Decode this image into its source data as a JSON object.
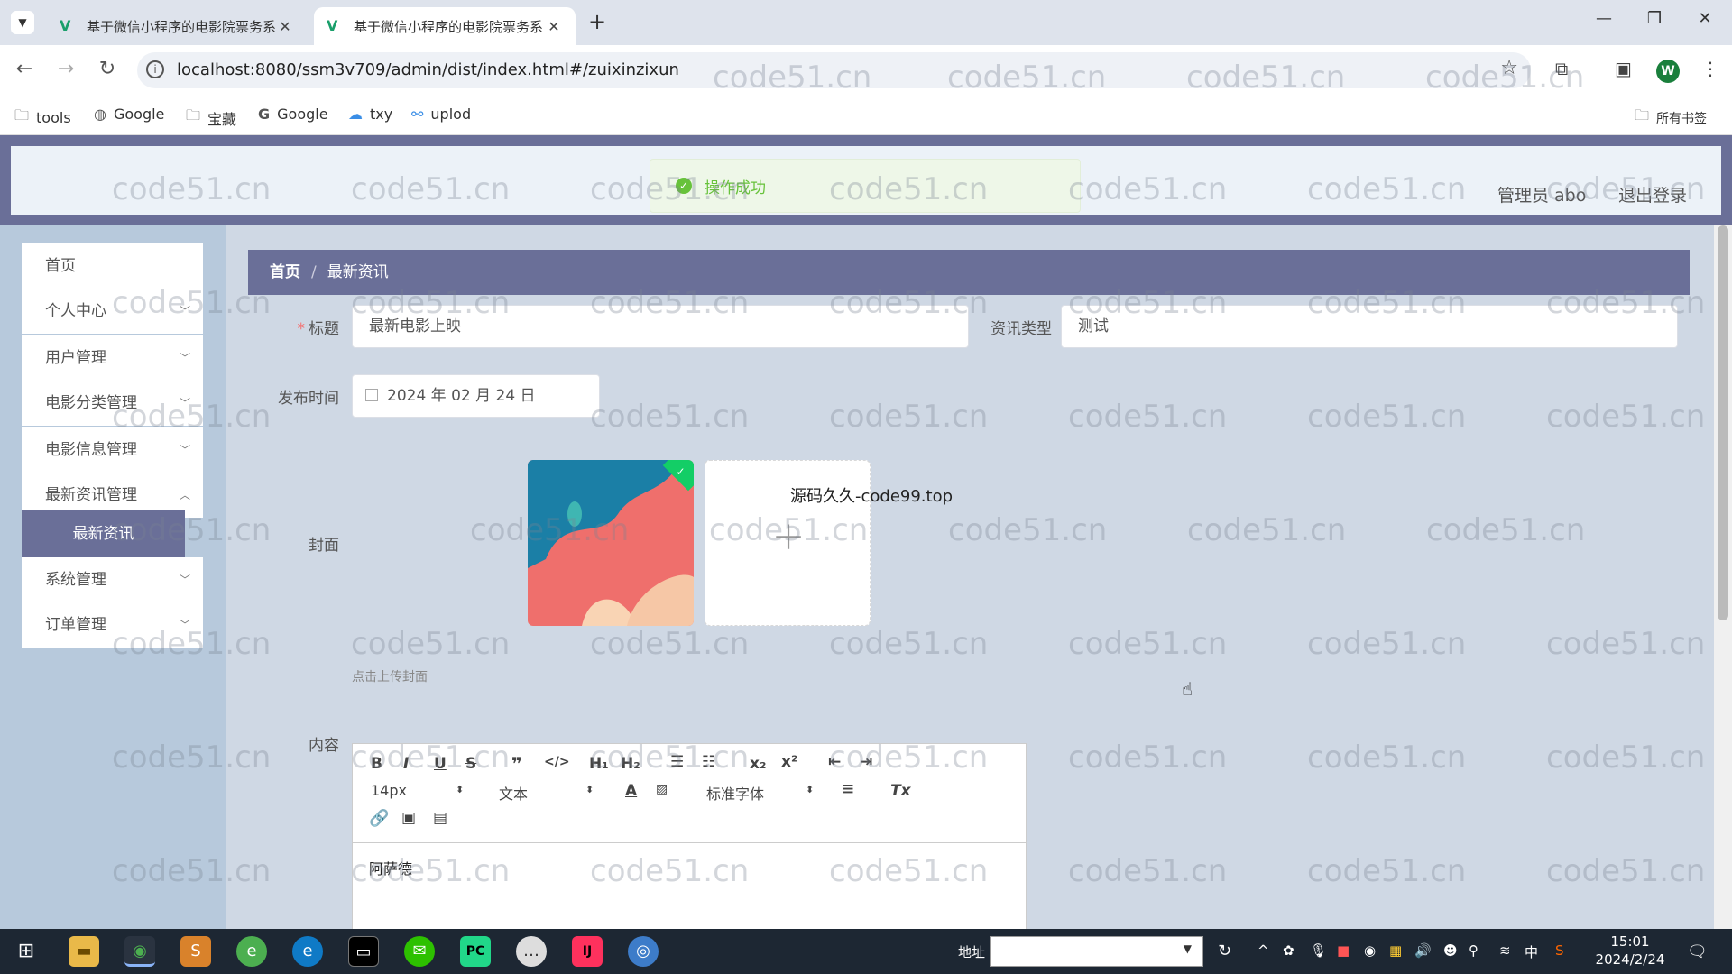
{
  "browser": {
    "tabs": [
      {
        "title": "基于微信小程序的电影院票务系",
        "active": false
      },
      {
        "title": "基于微信小程序的电影院票务系",
        "active": true
      }
    ],
    "url": "localhost:8080/ssm3v709/admin/dist/index.html#/zuixinzixun",
    "bookmarks": [
      "tools",
      "Google",
      "宝藏",
      "Google",
      "txy",
      "uplod"
    ],
    "all_bookmarks": "所有书签",
    "profile_initial": "W"
  },
  "app": {
    "toast": "操作成功",
    "admin_label": "管理员 abo",
    "logout": "退出登录",
    "sidebar": {
      "items": [
        {
          "label": "首页"
        },
        {
          "label": "个人中心"
        },
        {
          "label": "用户管理"
        },
        {
          "label": "电影分类管理"
        },
        {
          "label": "电影信息管理"
        },
        {
          "label": "最新资讯管理"
        },
        {
          "label": "最新资讯"
        },
        {
          "label": "系统管理"
        },
        {
          "label": "订单管理"
        }
      ]
    },
    "breadcrumb": {
      "home": "首页",
      "sep": "/",
      "current": "最新资讯"
    },
    "form": {
      "title_label": "标题",
      "title_value": "最新电影上映",
      "type_label": "资讯类型",
      "type_value": "测试",
      "time_label": "发布时间",
      "time_value": "2024 年 02 月 24 日",
      "cover_label": "封面",
      "upload_hint": "点击上传封面",
      "content_label": "内容",
      "font_size": "14px",
      "text_format": "文本",
      "font_family": "标准字体",
      "content_value": "阿萨德"
    },
    "overlay_text": "源码久久-code99.top",
    "watermark": "code51.cn"
  },
  "taskbar": {
    "addr_label": "地址",
    "time": "15:01",
    "date": "2024/2/24",
    "ime": "中"
  },
  "colors": {
    "header_purple": "#6a6f98",
    "success": "#67c23a",
    "required": "#f56c6c"
  }
}
